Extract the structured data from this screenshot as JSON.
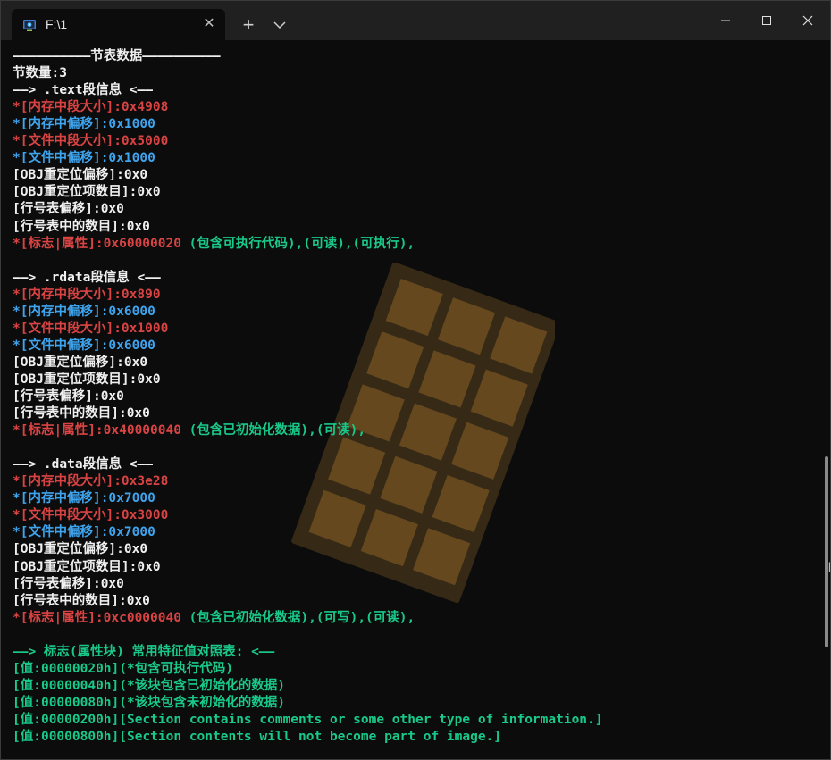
{
  "tab": {
    "title": "F:\\1",
    "close_glyph": "✕",
    "icon": "terminal-app-icon"
  },
  "titlebar": {
    "new_tab_glyph": "+",
    "dropdown_icon": "chevron-down-icon",
    "minimize_icon": "minimize-icon",
    "maximize_icon": "maximize-icon",
    "close_icon": "close-icon"
  },
  "colors": {
    "white": "#f0f0f0",
    "red": "#d94343",
    "blue": "#3fa4ee",
    "green": "#19c98a",
    "background": "#0c0c0c"
  },
  "watermark": {
    "icon": "chocolate-bar-watermark"
  },
  "edge_glyph": "[",
  "lines": [
    {
      "text": "——————————节表数据——————————",
      "color": "w"
    },
    {
      "text": "节数量:3",
      "color": "w"
    },
    {
      "text": "——> .text段信息 <——",
      "color": "w"
    },
    {
      "text": "*[内存中段大小]:0x4908",
      "color": "r"
    },
    {
      "text": "*[内存中偏移]:0x1000",
      "color": "b"
    },
    {
      "text": "*[文件中段大小]:0x5000",
      "color": "r"
    },
    {
      "text": "*[文件中偏移]:0x1000",
      "color": "b"
    },
    {
      "text": "[OBJ重定位偏移]:0x0",
      "color": "w"
    },
    {
      "text": "[OBJ重定位项数目]:0x0",
      "color": "w"
    },
    {
      "text": "[行号表偏移]:0x0",
      "color": "w"
    },
    {
      "text": "[行号表中的数目]:0x0",
      "color": "w"
    },
    {
      "text": "*[标志|属性]:0x60000020",
      "color": "r",
      "suffix": " (包含可执行代码),(可读),(可执行),",
      "suffix_color": "g"
    },
    {
      "text": "",
      "color": "w"
    },
    {
      "text": "——> .rdata段信息 <——",
      "color": "w"
    },
    {
      "text": "*[内存中段大小]:0x890",
      "color": "r"
    },
    {
      "text": "*[内存中偏移]:0x6000",
      "color": "b"
    },
    {
      "text": "*[文件中段大小]:0x1000",
      "color": "r"
    },
    {
      "text": "*[文件中偏移]:0x6000",
      "color": "b"
    },
    {
      "text": "[OBJ重定位偏移]:0x0",
      "color": "w"
    },
    {
      "text": "[OBJ重定位项数目]:0x0",
      "color": "w"
    },
    {
      "text": "[行号表偏移]:0x0",
      "color": "w"
    },
    {
      "text": "[行号表中的数目]:0x0",
      "color": "w"
    },
    {
      "text": "*[标志|属性]:0x40000040",
      "color": "r",
      "suffix": " (包含已初始化数据),(可读),",
      "suffix_color": "g"
    },
    {
      "text": "",
      "color": "w"
    },
    {
      "text": "——> .data段信息 <——",
      "color": "w"
    },
    {
      "text": "*[内存中段大小]:0x3e28",
      "color": "r"
    },
    {
      "text": "*[内存中偏移]:0x7000",
      "color": "b"
    },
    {
      "text": "*[文件中段大小]:0x3000",
      "color": "r"
    },
    {
      "text": "*[文件中偏移]:0x7000",
      "color": "b"
    },
    {
      "text": "[OBJ重定位偏移]:0x0",
      "color": "w"
    },
    {
      "text": "[OBJ重定位项数目]:0x0",
      "color": "w"
    },
    {
      "text": "[行号表偏移]:0x0",
      "color": "w"
    },
    {
      "text": "[行号表中的数目]:0x0",
      "color": "w"
    },
    {
      "text": "*[标志|属性]:0xc0000040",
      "color": "r",
      "suffix": " (包含已初始化数据),(可写),(可读),",
      "suffix_color": "g"
    },
    {
      "text": "",
      "color": "w"
    },
    {
      "text": "——> 标志(属性块) 常用特征值对照表: <——",
      "color": "g"
    },
    {
      "text": "[值:00000020h](*包含可执行代码)",
      "color": "g"
    },
    {
      "text": "[值:00000040h](*该块包含已初始化的数据)",
      "color": "g"
    },
    {
      "text": "[值:00000080h](*该块包含未初始化的数据)",
      "color": "g"
    },
    {
      "text": "[值:00000200h][Section contains comments or some other type of information.]",
      "color": "g"
    },
    {
      "text": "[值:00000800h][Section contents will not become part of image.]",
      "color": "g"
    }
  ]
}
